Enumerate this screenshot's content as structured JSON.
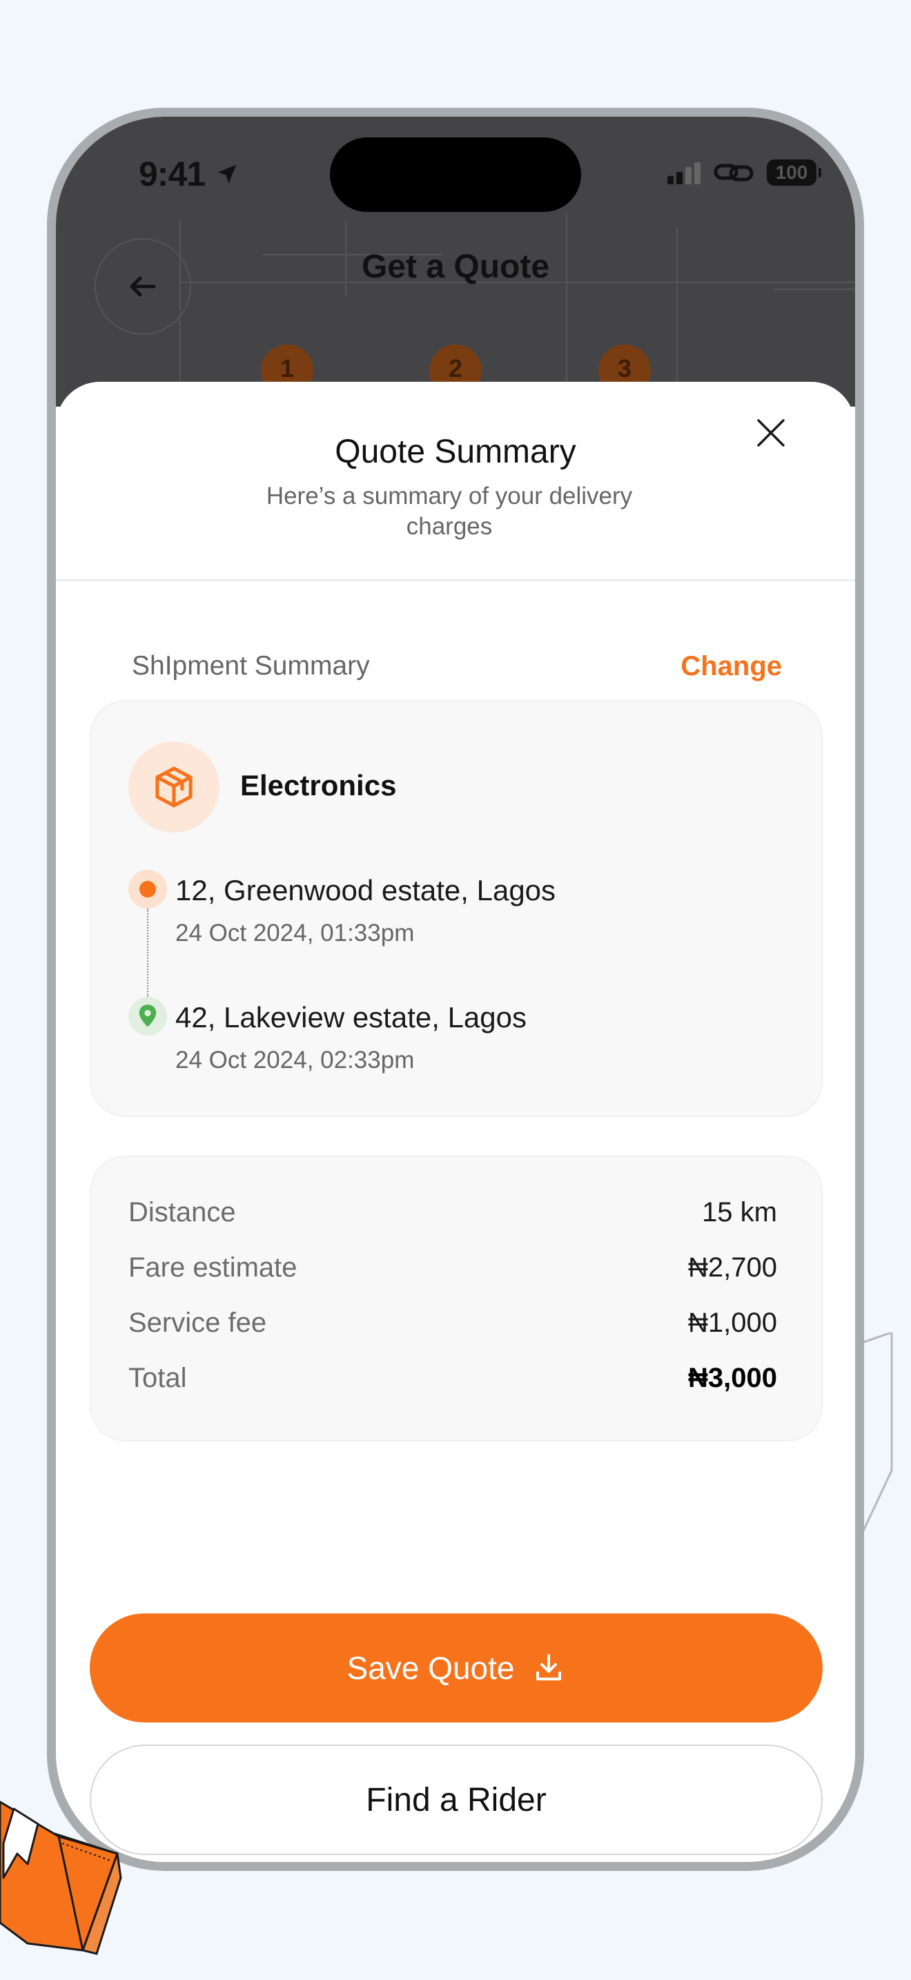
{
  "status_bar": {
    "time": "9:41",
    "battery": "100"
  },
  "background_screen": {
    "title": "Get a Quote",
    "steps": [
      "1",
      "2",
      "3"
    ]
  },
  "sheet": {
    "title": "Quote Summary",
    "subtitle": "Here’s a summary of your delivery charges",
    "shipment_label": "ShIpment Summary",
    "change_label": "Change",
    "category": "Electronics",
    "pickup": {
      "address": "12, Greenwood estate, Lagos",
      "time": "24 Oct 2024, 01:33pm"
    },
    "dropoff": {
      "address": "42, Lakeview estate, Lagos",
      "time": "24 Oct 2024, 02:33pm"
    },
    "fare": [
      {
        "label": "Distance",
        "value": "15 km"
      },
      {
        "label": "Fare estimate",
        "value": "₦2,700"
      },
      {
        "label": "Service fee",
        "value": "₦1,000"
      },
      {
        "label": "Total",
        "value": "₦3,000"
      }
    ],
    "save_button": "Save Quote",
    "find_button": "Find a Rider"
  },
  "colors": {
    "accent": "#f6731c",
    "page_background": "#f1f7fc",
    "pickup_dot": "#f6731c",
    "dropoff_pin": "#4caf50"
  },
  "icons": [
    "navigation-arrow-icon",
    "signal-icon",
    "link-icon",
    "battery-icon",
    "back-arrow-icon",
    "close-icon",
    "package-icon",
    "location-pin-icon",
    "download-icon"
  ]
}
